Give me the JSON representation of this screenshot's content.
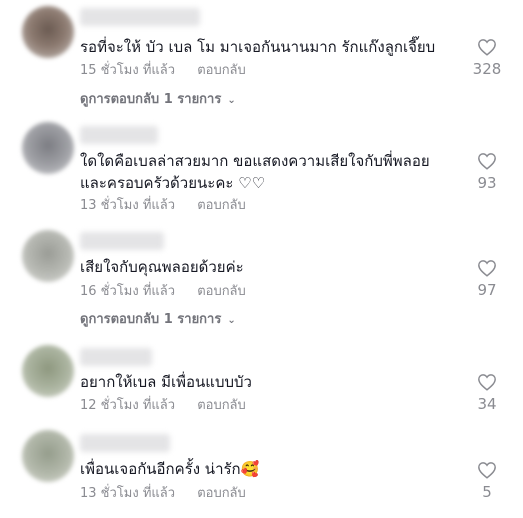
{
  "comments": [
    {
      "text": "รอที่จะให้ บัว เบล โม มาเจอกันนานมาก รักแก๊งลูกเจี๊ยบ",
      "time": "15 ชั่วโมง ที่แล้ว",
      "reply": "ตอบกลับ",
      "likes": "328",
      "view_replies": "ดูการตอบกลับ 1 รายการ",
      "avatar_color": "#7d6b62"
    },
    {
      "text": "ใดใดคือเบลล่าสวยมาก ขอแสดงความเสียใจกับพี่พลอย\nและครอบครัวด้วยนะคะ ♡♡",
      "time": "13 ชั่วโมง ที่แล้ว",
      "reply": "ตอบกลับ",
      "likes": "93",
      "avatar_color": "#8f9095"
    },
    {
      "text": "เสียใจกับคุณพลอยด้วยค่ะ",
      "time": "16 ชั่วโมง ที่แล้ว",
      "reply": "ตอบกลับ",
      "likes": "97",
      "view_replies": "ดูการตอบกลับ 1 รายการ",
      "avatar_color": "#a7a9a4"
    },
    {
      "text": "อยากให้เบล มีเพื่อนแบบบัว",
      "time": "12 ชั่วโมง ที่แล้ว",
      "reply": "ตอบกลับ",
      "likes": "34",
      "avatar_color": "#a0a894"
    },
    {
      "text": "เพื่อนเจอกันอีกครั้ง น่ารัก🥰",
      "time": "13 ชั่วโมง ที่แล้ว",
      "reply": "ตอบกลับ",
      "likes": "5",
      "avatar_color": "#a6ad9e"
    }
  ]
}
